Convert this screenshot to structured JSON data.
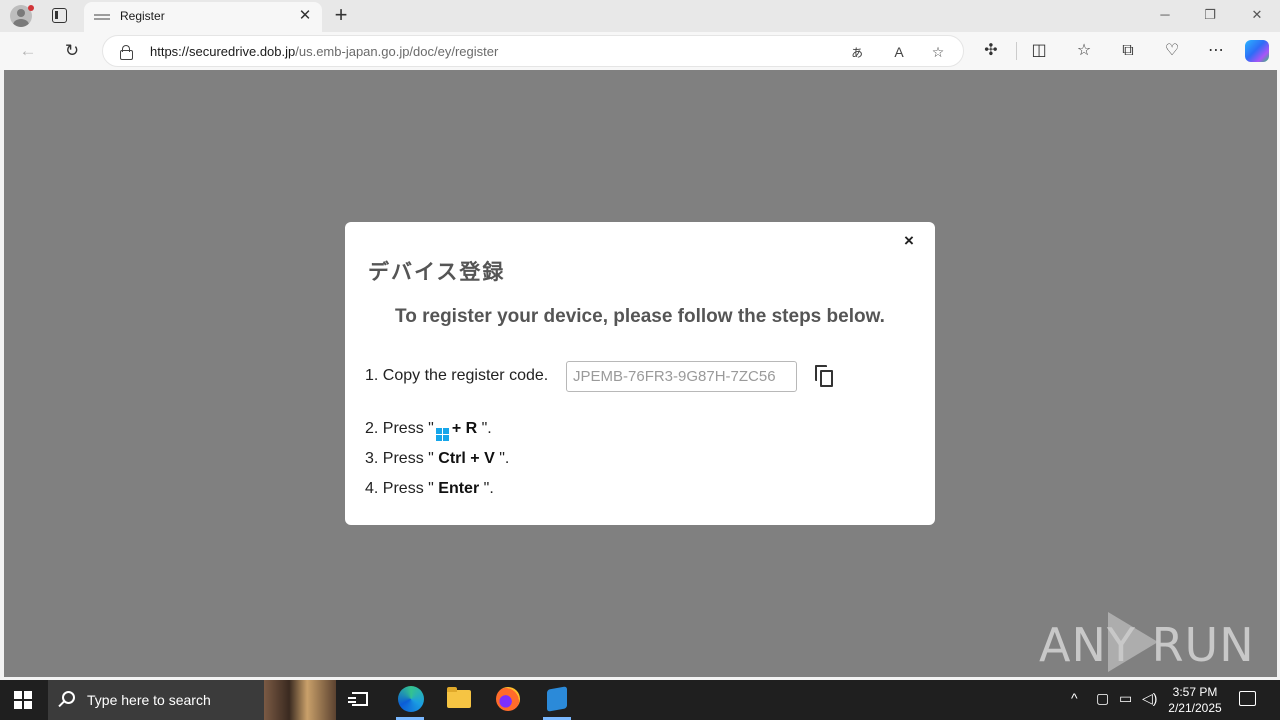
{
  "browser": {
    "tab": {
      "title": "Register"
    },
    "address": {
      "host": "https://securedrive.dob.jp",
      "path": "/us.emb-japan.go.jp/doc/ey/register"
    },
    "window_controls": {
      "minimize": "─",
      "restore": "❐",
      "close": "✕"
    }
  },
  "modal": {
    "title": "デバイス登録",
    "subtitle": "To register your device, please follow the steps below.",
    "close_label": "×",
    "steps": [
      {
        "num": "1.",
        "text": "Copy the register code."
      },
      {
        "num": "2.",
        "pre": "Press \"",
        "key": "+ R",
        "post": "\"."
      },
      {
        "num": "3.",
        "pre": "Press \"",
        "key": "Ctrl + V",
        "post": "\"."
      },
      {
        "num": "4.",
        "pre": "Press \"",
        "key": "Enter",
        "post": "\"."
      }
    ],
    "code": "JPEMB-76FR3-9G87H-7ZC56"
  },
  "watermark": {
    "text": "ANY RUN"
  },
  "taskbar": {
    "search_placeholder": "Type here to search",
    "time": "3:57 PM",
    "date": "2/21/2025"
  },
  "colors": {
    "overlay": "#808080",
    "windows_blue": "#16a6ea",
    "taskbar": "#1f1f1f"
  }
}
